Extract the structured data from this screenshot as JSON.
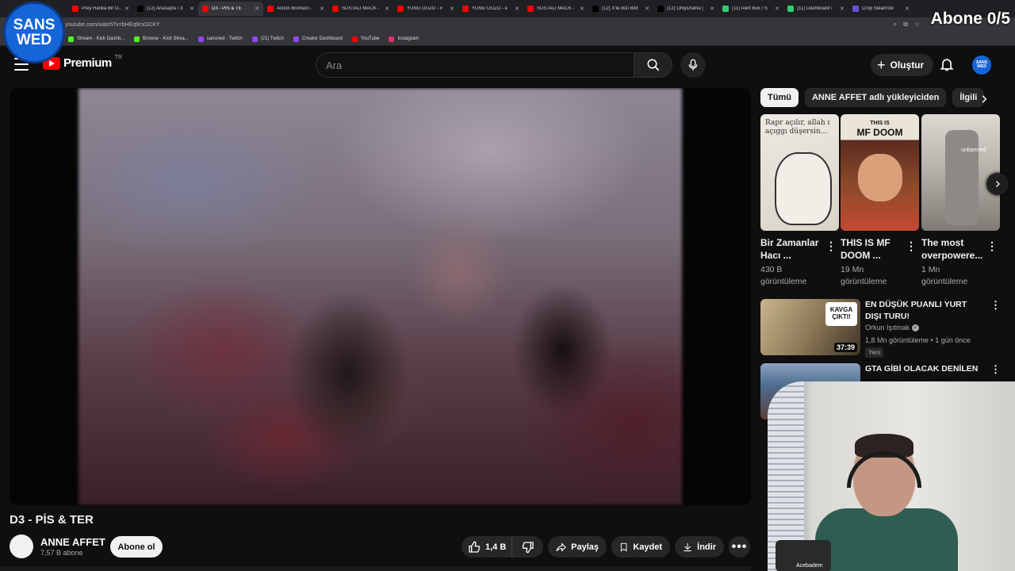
{
  "browser": {
    "tabs": [
      {
        "label": "Prey Harika Bir O...",
        "fav": "#ff0000"
      },
      {
        "label": "(12) Anasayfa / X",
        "fav": "#000000"
      },
      {
        "label": "D3 - PİS & TE",
        "fav": "#ff0000",
        "active": true
      },
      {
        "label": "Action Bronson -",
        "fav": "#ff0000"
      },
      {
        "label": "SUSTALI MACK -",
        "fav": "#ff0000"
      },
      {
        "label": "YUNG OUZO - #",
        "fav": "#ff0000"
      },
      {
        "label": "YUNG OUZO - e",
        "fav": "#ff0000"
      },
      {
        "label": "SUSTALI MACK -",
        "fav": "#ff0000"
      },
      {
        "label": "(12) X'te Bizi Bitir",
        "fav": "#000000"
      },
      {
        "label": "(12) OnlyDrama |",
        "fav": "#000000"
      },
      {
        "label": "(11) Alert Box / S",
        "fav": "#2ecc71"
      },
      {
        "label": "(11) Dashboard /",
        "fav": "#2ecc71"
      },
      {
        "label": "Crop Steam'de",
        "fav": "#6a4fd8"
      }
    ],
    "address": "youtube.com/watch?v=bHEq9cxDCKY",
    "bookmarks": [
      {
        "label": "Stream - Kick Dashb...",
        "color": "#53fc18"
      },
      {
        "label": "Browse - Kick Strea...",
        "color": "#53fc18"
      },
      {
        "label": "sansned - Twitch",
        "color": "#9146ff"
      },
      {
        "label": "(21) Twitch",
        "color": "#9146ff"
      },
      {
        "label": "Creator Dashboard",
        "color": "#9146ff"
      },
      {
        "label": "YouTube",
        "color": "#ff0000"
      },
      {
        "label": "Instagram",
        "color": "#e1306c"
      }
    ]
  },
  "overlay": {
    "logo_line1": "SANS",
    "logo_line2": "WED",
    "abone": "Abone 0/5"
  },
  "header": {
    "brand": "Premium",
    "country": "TR",
    "search_placeholder": "Ara",
    "create_label": "Oluştur",
    "avatar_line1": "SANS",
    "avatar_line2": "WED"
  },
  "video": {
    "title": "D3 - PİS & TER",
    "channel": "ANNE AFFET",
    "subscribers": "7,57 B abone",
    "subscribe_label": "Abone ol",
    "likes": "1,4 B",
    "share_label": "Paylaş",
    "save_label": "Kaydet",
    "download_label": "İndir"
  },
  "chips": [
    "Tümü",
    "ANNE AFFET adlı yükleyiciden",
    "İlgili"
  ],
  "shelf": [
    {
      "title": "Bir Zamanlar Hacı ...",
      "views_line1": "430 B",
      "views_line2": "görüntüleme",
      "thumb_text": "Rapr açılır, allah ı açıggı düşersin..."
    },
    {
      "title": "THIS IS MF DOOM ...",
      "views_line1": "19 Mn",
      "views_line2": "görüntüleme",
      "thumb_small": "THIS IS",
      "thumb_big": "MF DOOM"
    },
    {
      "title": "The most overpowere...",
      "views_line1": "1 Mn",
      "views_line2": "görüntüleme",
      "thumb_text": "unbanned"
    }
  ],
  "recommendations": [
    {
      "title": "EN DÜŞÜK PUANLI YURT DIŞI TURU!",
      "channel": "Orkun Işıtmak",
      "meta": "1,8 Mn görüntüleme • 1 gün önce",
      "badge": "Yeni",
      "duration": "37:39",
      "thumb_text": "KAVGA ÇIKTI!"
    },
    {
      "title": "GTA GİBİ OLACAK DENİLEN"
    }
  ],
  "webcam": {
    "label": "Acebadem"
  }
}
